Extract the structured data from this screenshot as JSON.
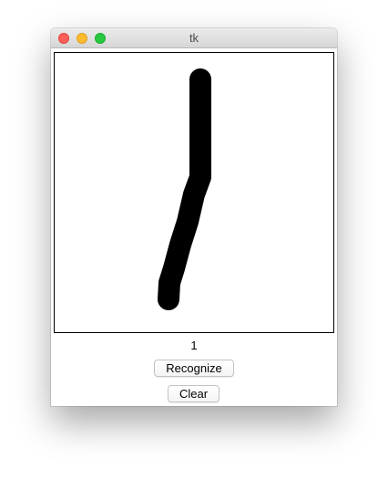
{
  "window": {
    "title": "tk"
  },
  "canvas": {
    "description_color": "#000000",
    "background": "#ffffff"
  },
  "result": {
    "text": "1"
  },
  "buttons": {
    "recognize_label": "Recognize",
    "clear_label": "Clear"
  }
}
